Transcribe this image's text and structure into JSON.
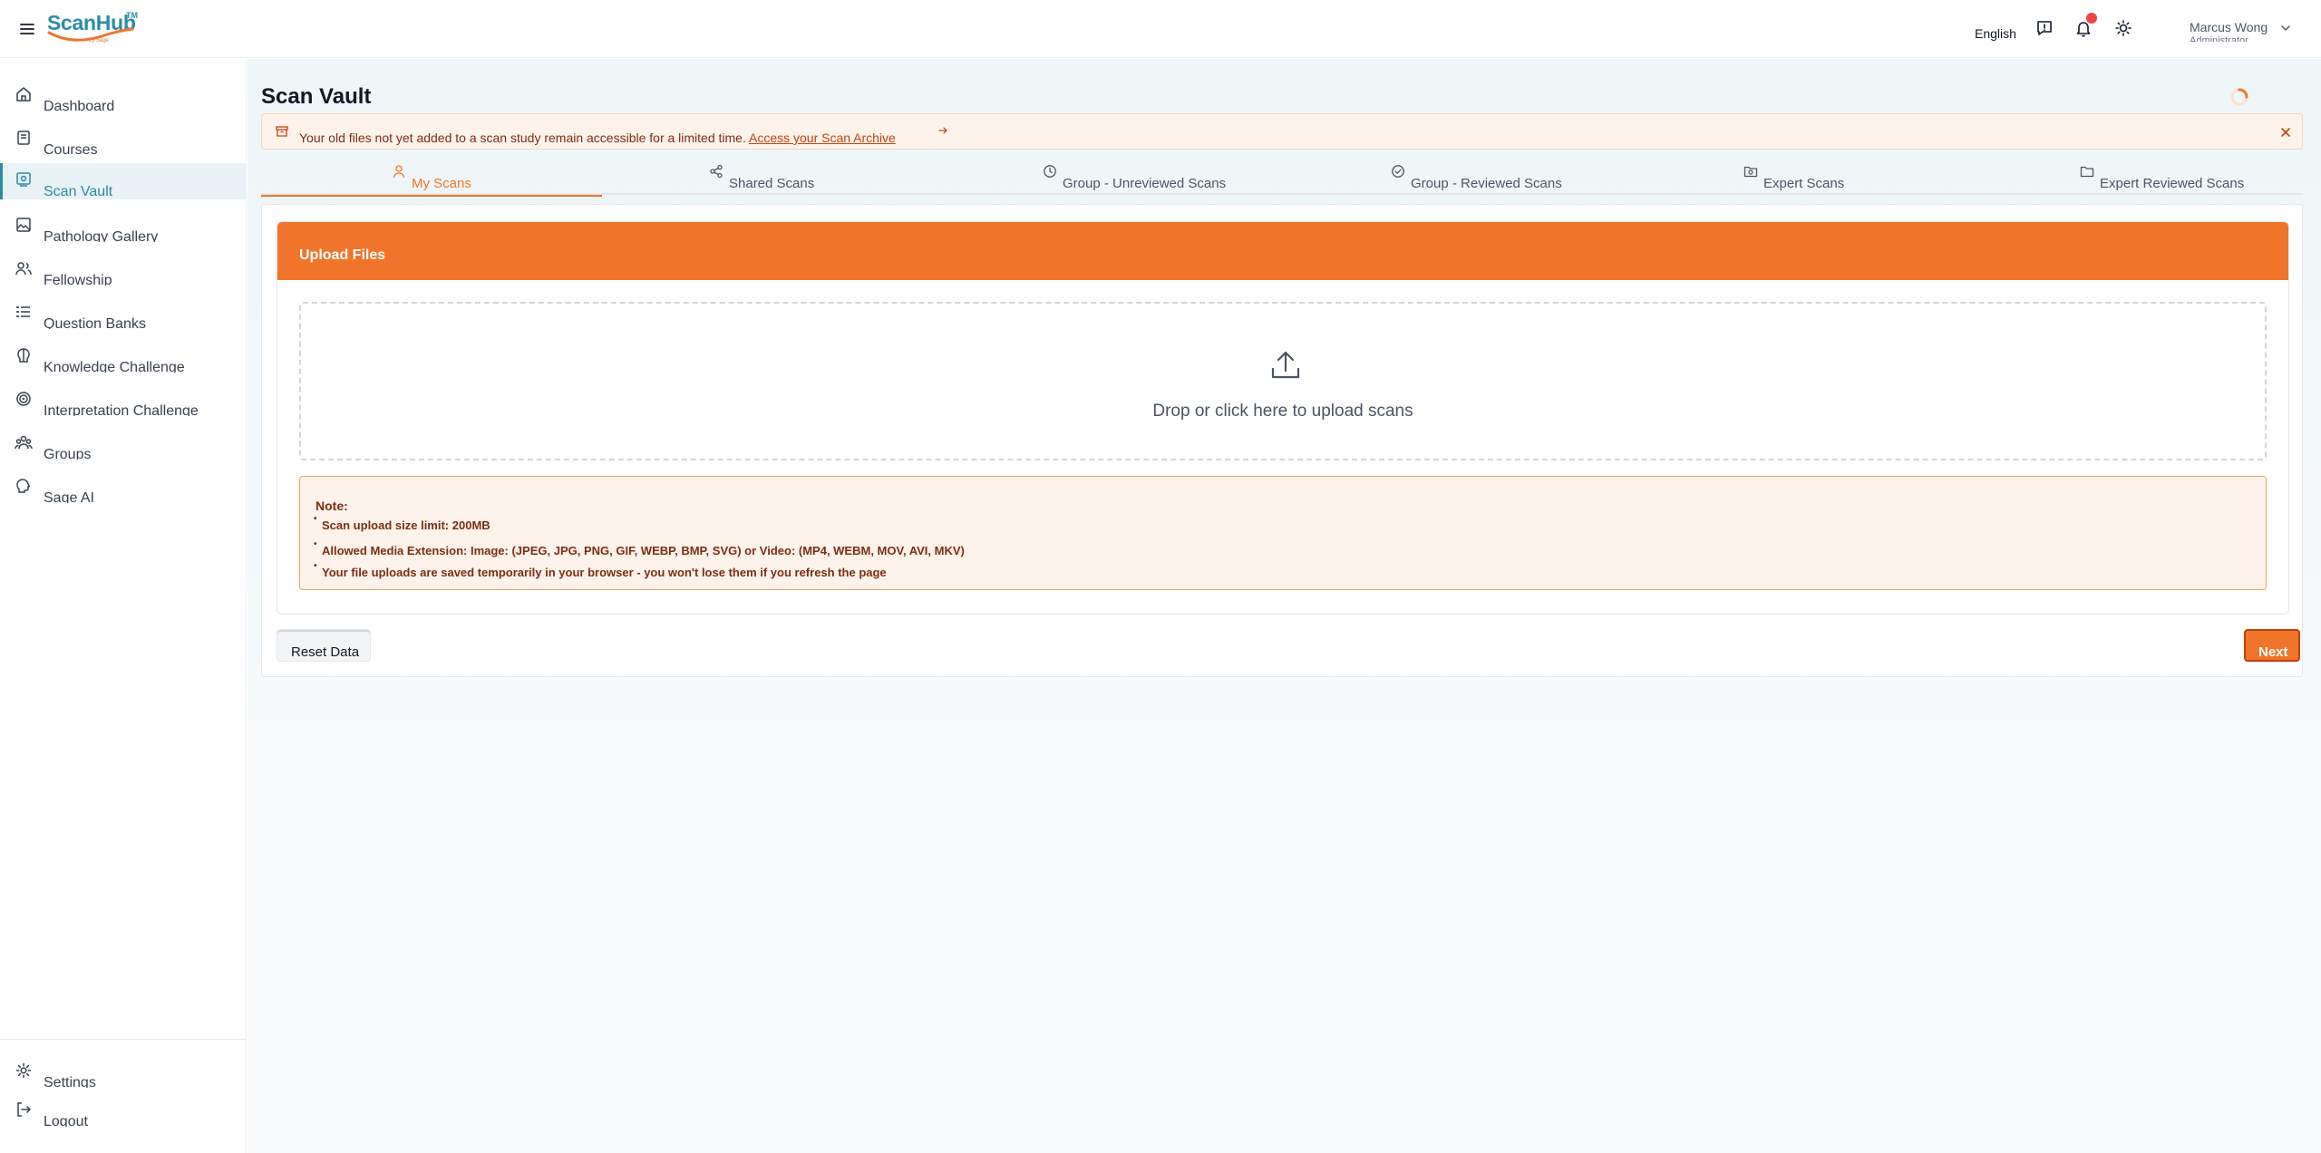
{
  "header": {
    "logo_text": "ScanHub",
    "logo_tm": "TM",
    "logo_sub": "by Sage",
    "language": "English",
    "icons": [
      "menu-icon",
      "feedback-icon",
      "bell-icon",
      "sun-icon",
      "chevron-down-icon"
    ],
    "user": {
      "name": "Marcus Wong",
      "role": "Administrator"
    }
  },
  "sidebar": {
    "items": [
      {
        "label": "Dashboard",
        "icon": "home-icon"
      },
      {
        "label": "Courses",
        "icon": "book-icon"
      },
      {
        "label": "Scan Vault",
        "icon": "scan-vault-icon",
        "active": true
      },
      {
        "label": "Pathology Gallery",
        "icon": "gallery-icon"
      },
      {
        "label": "Fellowship",
        "icon": "users-icon"
      },
      {
        "label": "Question Banks",
        "icon": "list-icon"
      },
      {
        "label": "Knowledge Challenge",
        "icon": "brain-icon"
      },
      {
        "label": "Interpretation Challenge",
        "icon": "target-icon"
      },
      {
        "label": "Groups",
        "icon": "group-icon"
      },
      {
        "label": "Sage AI",
        "icon": "ai-icon"
      }
    ],
    "footer": [
      {
        "label": "Settings",
        "icon": "gear-icon"
      },
      {
        "label": "Logout",
        "icon": "logout-icon"
      }
    ]
  },
  "main": {
    "title": "Scan Vault",
    "banner": {
      "text": "Your old files not yet added to a scan study remain accessible for a limited time.",
      "link": "Access your Scan Archive"
    },
    "tabs": [
      {
        "label": "My Scans",
        "icon": "user-icon",
        "active": true
      },
      {
        "label": "Shared Scans",
        "icon": "share-icon"
      },
      {
        "label": "Group - Unreviewed Scans",
        "icon": "clock-icon"
      },
      {
        "label": "Group - Reviewed Scans",
        "icon": "check-circle-icon"
      },
      {
        "label": "Expert Scans",
        "icon": "folder-search-icon"
      },
      {
        "label": "Expert Reviewed Scans",
        "icon": "folder-icon"
      }
    ],
    "upload": {
      "title": "Upload Files",
      "drop_text": "Drop or click here to upload scans",
      "note_title": "Note:",
      "notes": [
        "Scan upload size limit: 200MB",
        "Allowed Media Extension: Image: (JPEG, JPG, PNG, GIF, WEBP, BMP, SVG) or Video: (MP4, WEBM, MOV, AVI, MKV)",
        "Your file uploads are saved temporarily in your browser - you won't lose them if you refresh the page"
      ]
    },
    "actions": {
      "reset": "Reset Data",
      "next": "Next"
    }
  },
  "colors": {
    "accent": "#f0752a",
    "brand": "#2a8ca3",
    "danger": "#ef4444"
  }
}
